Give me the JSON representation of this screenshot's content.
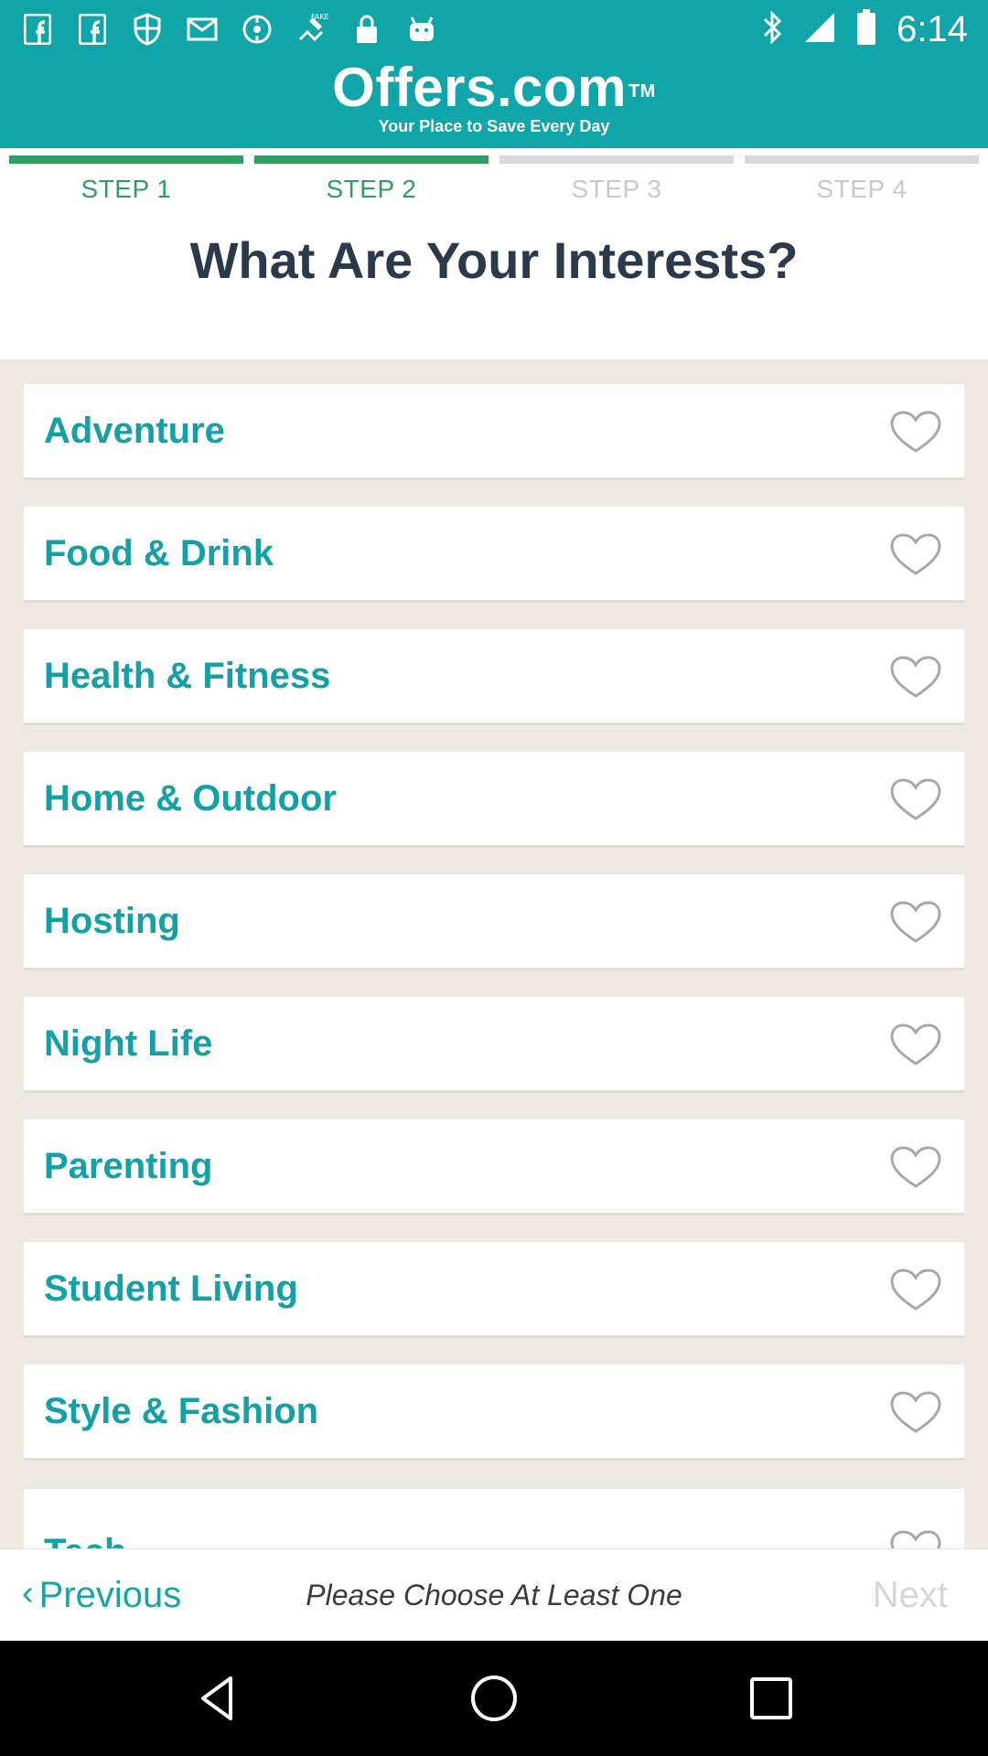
{
  "status_bar": {
    "time": "6:14",
    "left_icons": [
      "facebook-icon",
      "facebook-icon",
      "shield-icon",
      "mail-icon",
      "hotspot-icon",
      "fake-gps-icon",
      "lock-icon",
      "android-icon"
    ],
    "right_icons": [
      "bluetooth-icon",
      "signal-icon",
      "battery-icon"
    ]
  },
  "header": {
    "brand": "Offers.com",
    "tm": "TM",
    "tagline": "Your Place to Save Every Day"
  },
  "steps": [
    {
      "label": "STEP 1",
      "active": true
    },
    {
      "label": "STEP 2",
      "active": true
    },
    {
      "label": "STEP 3",
      "active": false
    },
    {
      "label": "STEP 4",
      "active": false
    }
  ],
  "page_title": "What Are Your Interests?",
  "interests": [
    {
      "label": "Adventure",
      "icon": "heart-outline-icon"
    },
    {
      "label": "Food & Drink",
      "icon": "heart-outline-icon"
    },
    {
      "label": "Health & Fitness",
      "icon": "heart-outline-icon"
    },
    {
      "label": "Home & Outdoor",
      "icon": "heart-outline-icon"
    },
    {
      "label": "Hosting",
      "icon": "heart-outline-icon"
    },
    {
      "label": "Night Life",
      "icon": "heart-outline-icon"
    },
    {
      "label": "Parenting",
      "icon": "heart-outline-icon"
    },
    {
      "label": "Student Living",
      "icon": "heart-outline-icon"
    },
    {
      "label": "Style & Fashion",
      "icon": "heart-outline-icon"
    },
    {
      "label": "Tech",
      "icon": "heart-outline-icon"
    }
  ],
  "footer": {
    "previous_label": "Previous",
    "previous_icon": "chevron-left-icon",
    "hint": "Please Choose At Least One",
    "next_label": "Next"
  },
  "colors": {
    "header_teal": "#0fa5a9",
    "step_active": "#2e9e63",
    "step_inactive": "#d9d9d9",
    "title": "#2b3a4a",
    "item_text": "#13a1a5",
    "list_background": "#ede9e1",
    "next_disabled": "#d6d6d6"
  },
  "system_nav": [
    "back-icon",
    "home-icon",
    "recents-icon"
  ]
}
